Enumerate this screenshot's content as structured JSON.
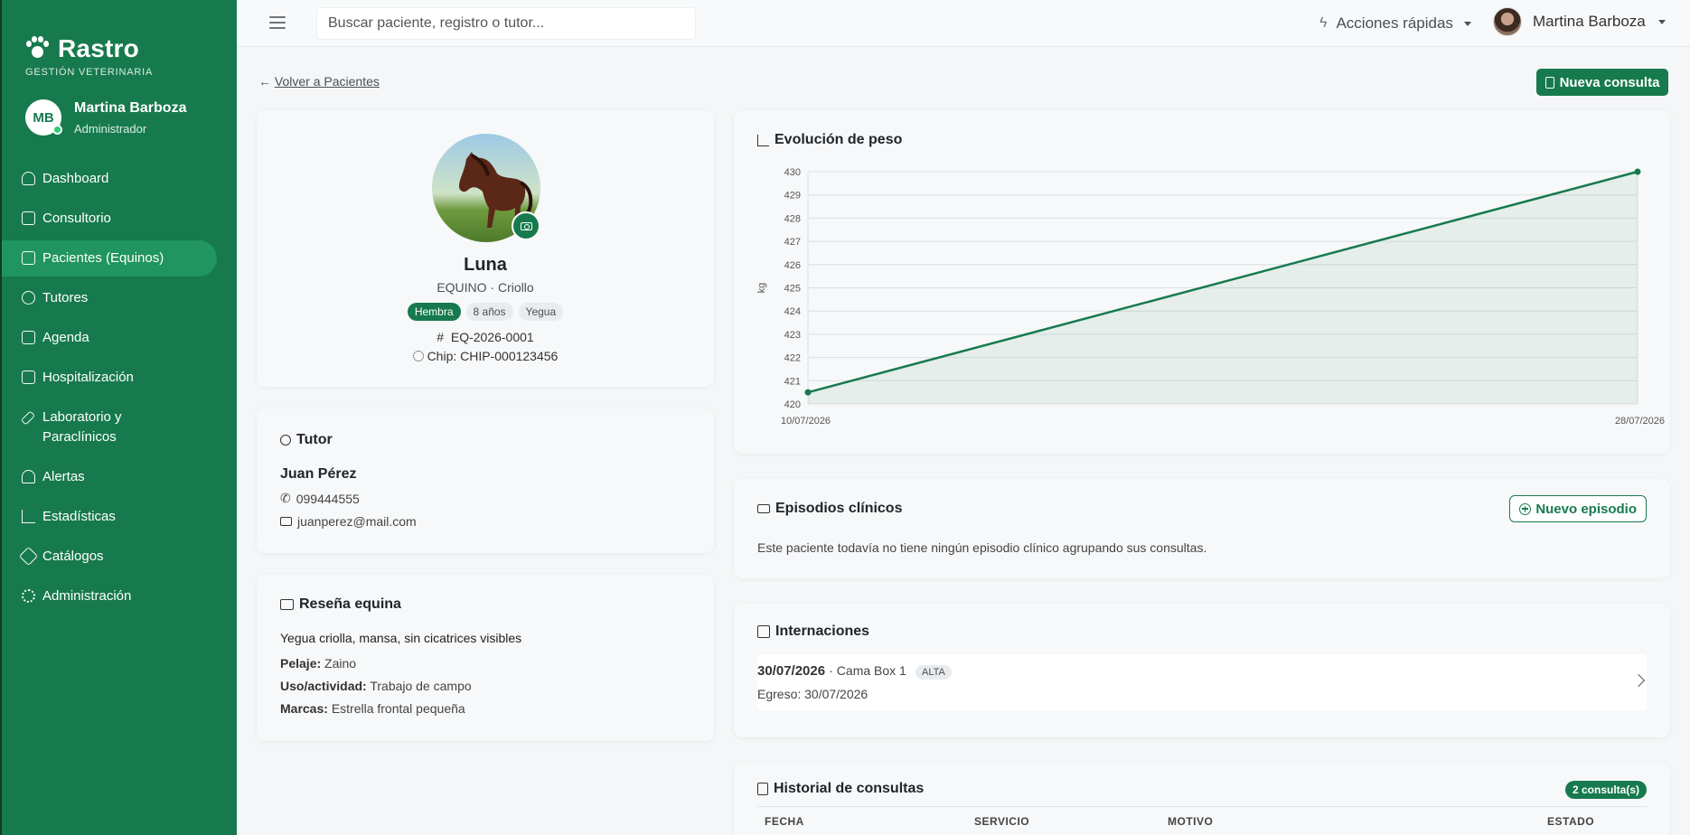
{
  "sidebar": {
    "brand": "Rastro",
    "brand_sub": "GESTIÓN VETERINARIA",
    "user_initials": "MB",
    "user_name": "Martina Barboza",
    "user_role": "Administrador",
    "items": [
      {
        "label": "Dashboard",
        "icon": "gauge-icon"
      },
      {
        "label": "Consultorio",
        "icon": "clipboard-icon"
      },
      {
        "label": "Pacientes (Equinos)",
        "icon": "patient-file-icon",
        "active": true
      },
      {
        "label": "Tutores",
        "icon": "people-icon"
      },
      {
        "label": "Agenda",
        "icon": "calendar-icon"
      },
      {
        "label": "Hospitalización",
        "icon": "hospital-icon"
      },
      {
        "label": "Laboratorio y Paraclínicos",
        "icon": "syringe-icon"
      },
      {
        "label": "Alertas",
        "icon": "bell-icon"
      },
      {
        "label": "Estadísticas",
        "icon": "chart-line-icon"
      },
      {
        "label": "Catálogos",
        "icon": "tag-icon"
      },
      {
        "label": "Administración",
        "icon": "gear-icon"
      }
    ]
  },
  "topbar": {
    "search_placeholder": "Buscar paciente, registro o tutor...",
    "quick_actions": "Acciones rápidas",
    "user_name": "Martina Barboza"
  },
  "main": {
    "back_arrow": "←",
    "back_label": "Volver a Pacientes",
    "new_consult": "Nueva consulta"
  },
  "patient": {
    "name": "Luna",
    "species": "EQUINO · Criollo",
    "badges": [
      "Hembra",
      "8 años",
      "Yegua"
    ],
    "id_prefix": "#",
    "id": "EQ-2026-0001",
    "chip": "Chip: CHIP-000123456"
  },
  "tutor": {
    "title": "Tutor",
    "name": "Juan Pérez",
    "phone": "099444555",
    "email": "juanperez@mail.com"
  },
  "resena": {
    "title": "Reseña equina",
    "description": "Yegua criolla, mansa, sin cicatrices visibles",
    "pelaje_label": "Pelaje:",
    "pelaje": "Zaino",
    "uso_label": "Uso/actividad:",
    "uso": "Trabajo de campo",
    "marcas_label": "Marcas:",
    "marcas": "Estrella frontal pequeña"
  },
  "chart_data": {
    "type": "area",
    "title": "Evolución de peso",
    "ylabel": "kg",
    "xlabel": "",
    "x": [
      "10/07/2026",
      "28/07/2026"
    ],
    "values": [
      420.5,
      430
    ],
    "ylim": [
      420,
      430
    ],
    "yticks": [
      420,
      421,
      422,
      423,
      424,
      425,
      426,
      427,
      428,
      429,
      430
    ],
    "grid": true,
    "line_color": "#177a4e"
  },
  "episodes": {
    "title": "Episodios clínicos",
    "new_button": "Nuevo episodio",
    "empty_text": "Este paciente todavía no tiene ningún episodio clínico agrupando sus consultas."
  },
  "internaciones": {
    "title": "Internaciones",
    "date": "30/07/2026",
    "bed": "· Cama Box 1",
    "status": "ALTA",
    "egreso": "Egreso: 30/07/2026"
  },
  "history": {
    "title": "Historial de consultas",
    "count": "2 consulta(s)",
    "columns": [
      "FECHA",
      "SERVICIO",
      "MOTIVO",
      "ESTADO"
    ]
  },
  "colors": {
    "brand": "#177a4e",
    "brand_active": "#20955f"
  }
}
